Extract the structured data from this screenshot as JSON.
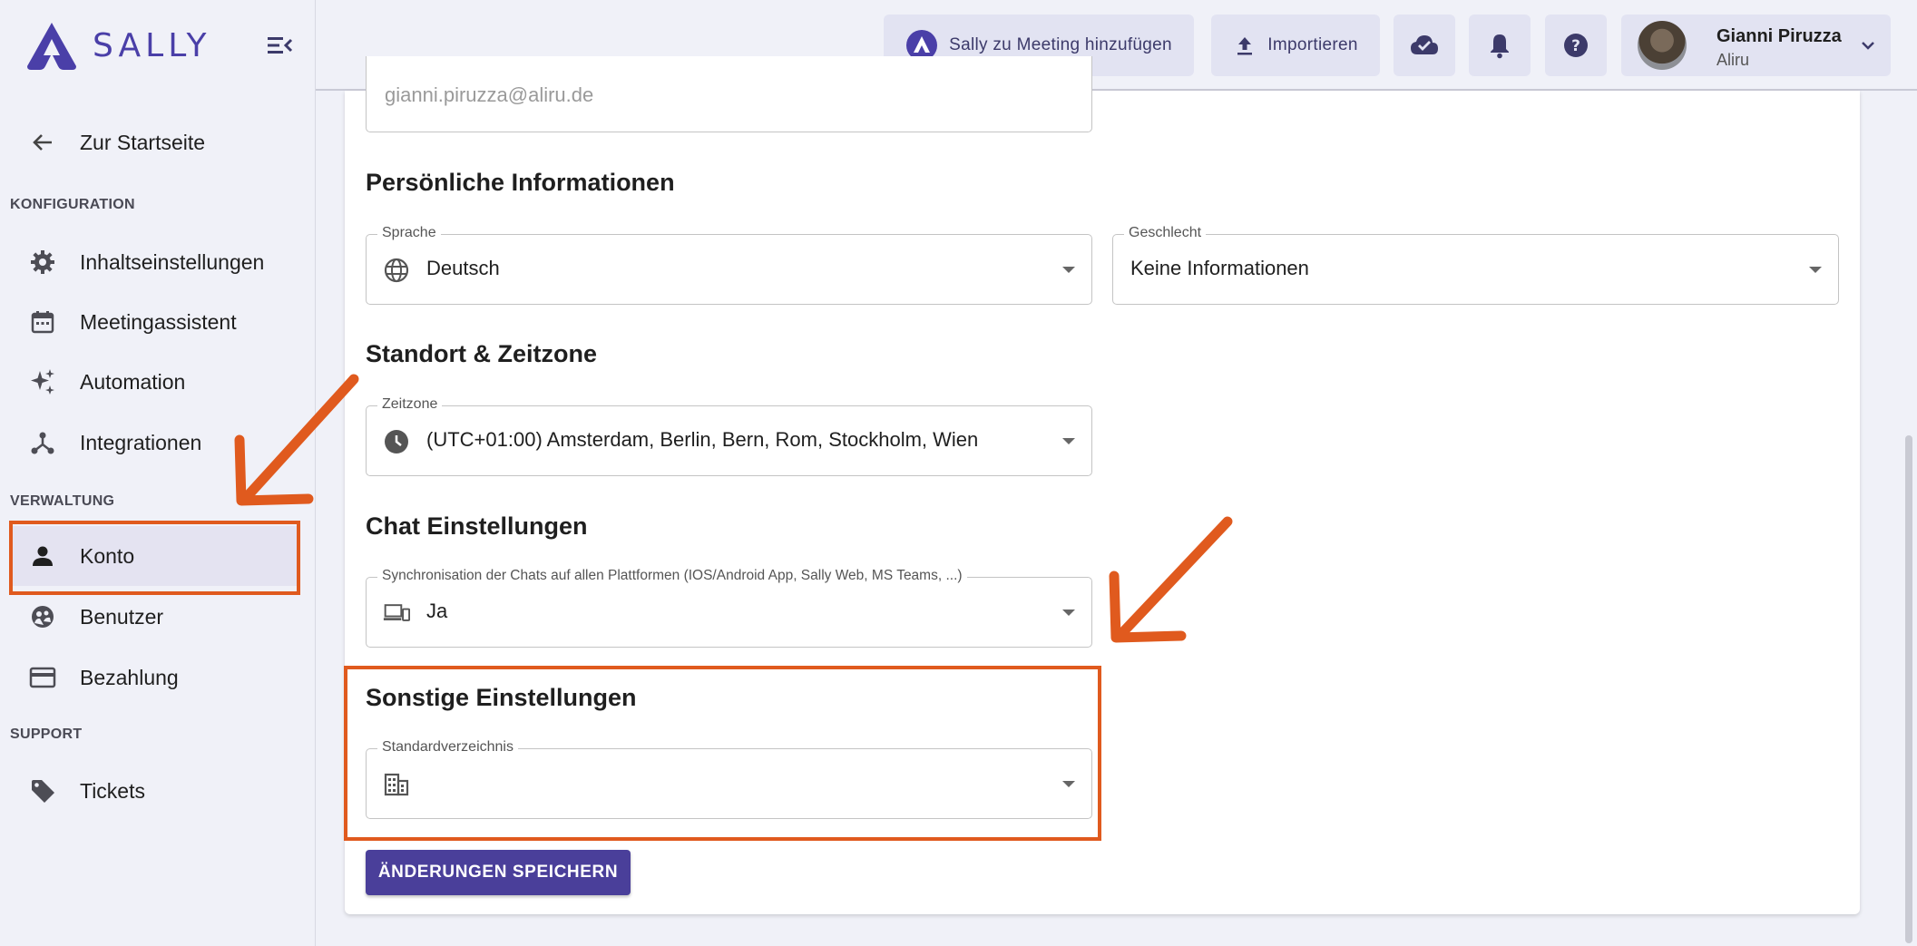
{
  "brand": {
    "name": "SALLY",
    "accent": "#4a3fa8",
    "highlight": "#e05a1e"
  },
  "sidebar": {
    "back_label": "Zur Startseite",
    "sections": {
      "config": "KONFIGURATION",
      "admin": "VERWALTUNG",
      "support": "SUPPORT"
    },
    "items": {
      "content": "Inhaltseinstellungen",
      "meeting": "Meetingassistent",
      "automation": "Automation",
      "integrations": "Integrationen",
      "account": "Konto",
      "users": "Benutzer",
      "billing": "Bezahlung",
      "tickets": "Tickets"
    },
    "active_item": "Konto"
  },
  "topbar": {
    "add_to_meeting": "Sally zu Meeting hinzufügen",
    "import": "Importieren",
    "icons": [
      "cloud-check-icon",
      "bell-icon",
      "help-icon"
    ],
    "user": {
      "name": "Gianni Piruzza",
      "org": "Aliru"
    }
  },
  "form": {
    "email_value": "gianni.piruzza@aliru.de",
    "personal": {
      "title": "Persönliche Informationen",
      "language_label": "Sprache",
      "language_value": "Deutsch",
      "gender_label": "Geschlecht",
      "gender_value": "Keine Informationen"
    },
    "location": {
      "title": "Standort & Zeitzone",
      "timezone_label": "Zeitzone",
      "timezone_value": "(UTC+01:00) Amsterdam, Berlin, Bern, Rom, Stockholm, Wien"
    },
    "chat": {
      "title": "Chat Einstellungen",
      "sync_label": "Synchronisation der Chats auf allen Plattformen (IOS/Android App, Sally Web, MS Teams, ...)",
      "sync_value": "Ja"
    },
    "other": {
      "title": "Sonstige Einstellungen",
      "directory_label": "Standardverzeichnis",
      "directory_value": ""
    },
    "save_label": "ÄNDERUNGEN SPEICHERN"
  }
}
